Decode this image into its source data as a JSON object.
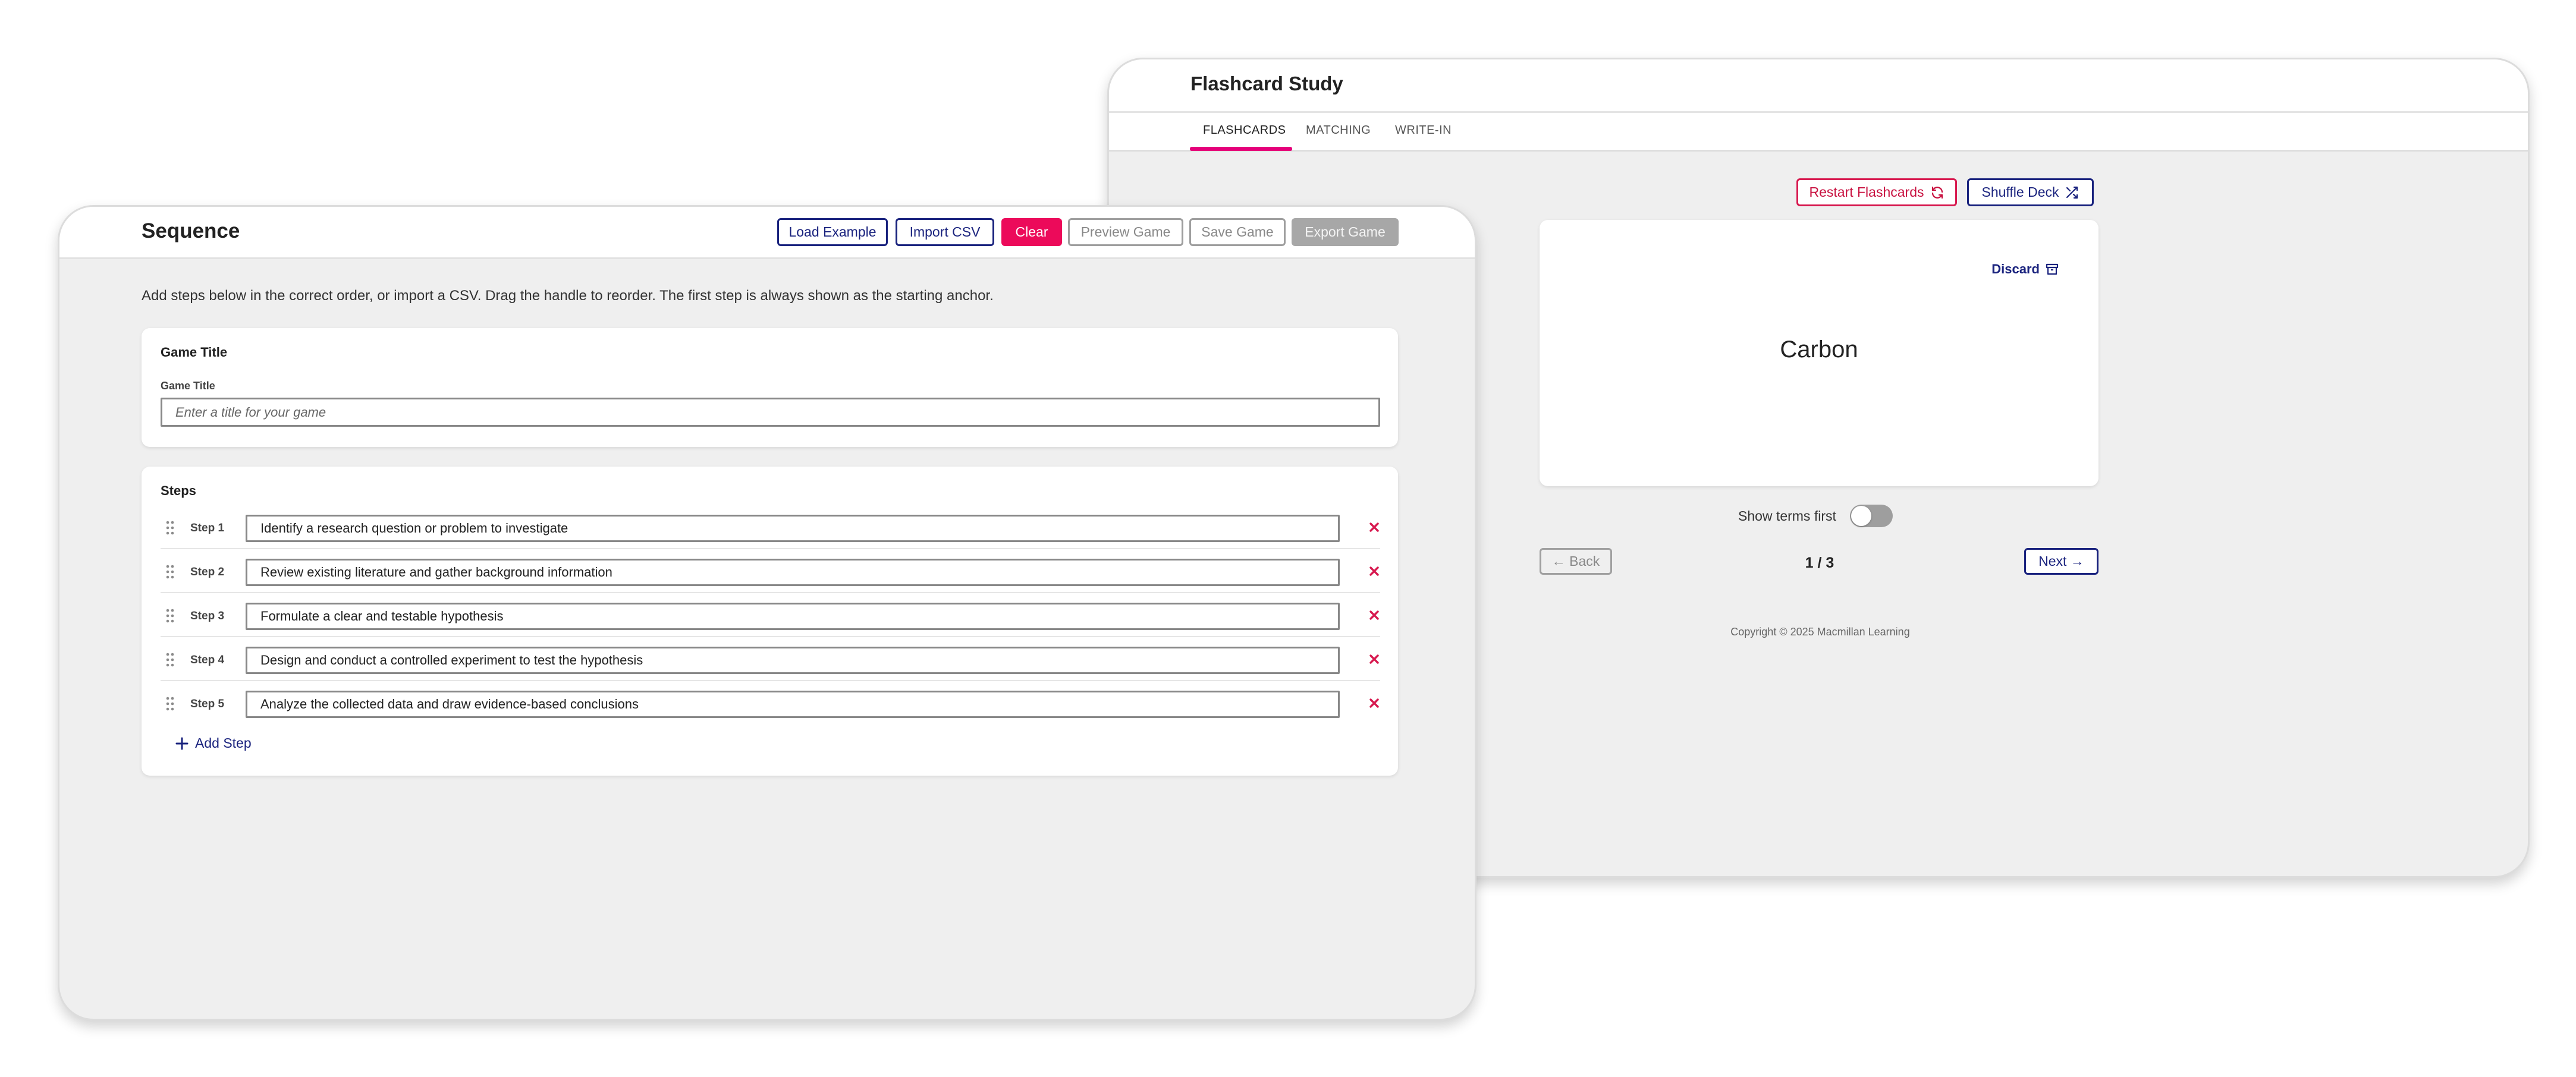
{
  "flashcard": {
    "title": "Flashcard Study",
    "tabs": [
      {
        "label": "FLASHCARDS",
        "active": true
      },
      {
        "label": "MATCHING",
        "active": false
      },
      {
        "label": "WRITE-IN",
        "active": false
      }
    ],
    "restart_label": "Restart Flashcards",
    "restart_icon": "refresh-icon",
    "shuffle_label": "Shuffle Deck",
    "shuffle_icon": "shuffle-icon",
    "discard_label": "Discard",
    "discard_icon": "archive-icon",
    "term": "Carbon",
    "show_terms_label": "Show terms first",
    "show_terms_on": false,
    "back_label": "← Back",
    "counter": "1 / 3",
    "next_label": "Next →",
    "copyright": "Copyright © 2025 Macmillan Learning",
    "colors": {
      "accent": "#e5007a",
      "navy": "#1a237e",
      "danger": "#c8103f"
    }
  },
  "sequence": {
    "title": "Sequence",
    "buttons": {
      "load_example": "Load Example",
      "import_csv": "Import CSV",
      "clear": "Clear",
      "preview_game": "Preview Game",
      "save_game": "Save Game",
      "export_game": "Export Game"
    },
    "instructions": "Add steps below in the correct order, or import a CSV. Drag the handle to reorder. The first step is always shown as the starting anchor.",
    "game_title_section": "Game Title",
    "game_title_label": "Game Title",
    "game_title_value": "",
    "game_title_placeholder": "Enter a title for your game",
    "steps_heading": "Steps",
    "steps": [
      {
        "label": "Step 1",
        "value": "Identify a research question or problem to investigate"
      },
      {
        "label": "Step 2",
        "value": "Review existing literature and gather background information"
      },
      {
        "label": "Step 3",
        "value": "Formulate a clear and testable hypothesis"
      },
      {
        "label": "Step 4",
        "value": "Design and conduct a controlled experiment to test the hypothesis"
      },
      {
        "label": "Step 5",
        "value": "Analyze the collected data and draw evidence-based conclusions"
      }
    ],
    "add_step_label": "Add Step",
    "colors": {
      "clear": "#ec0a5a",
      "navy": "#1a237e",
      "delete": "#d7194f",
      "disabled": "#a7a7a7"
    }
  }
}
